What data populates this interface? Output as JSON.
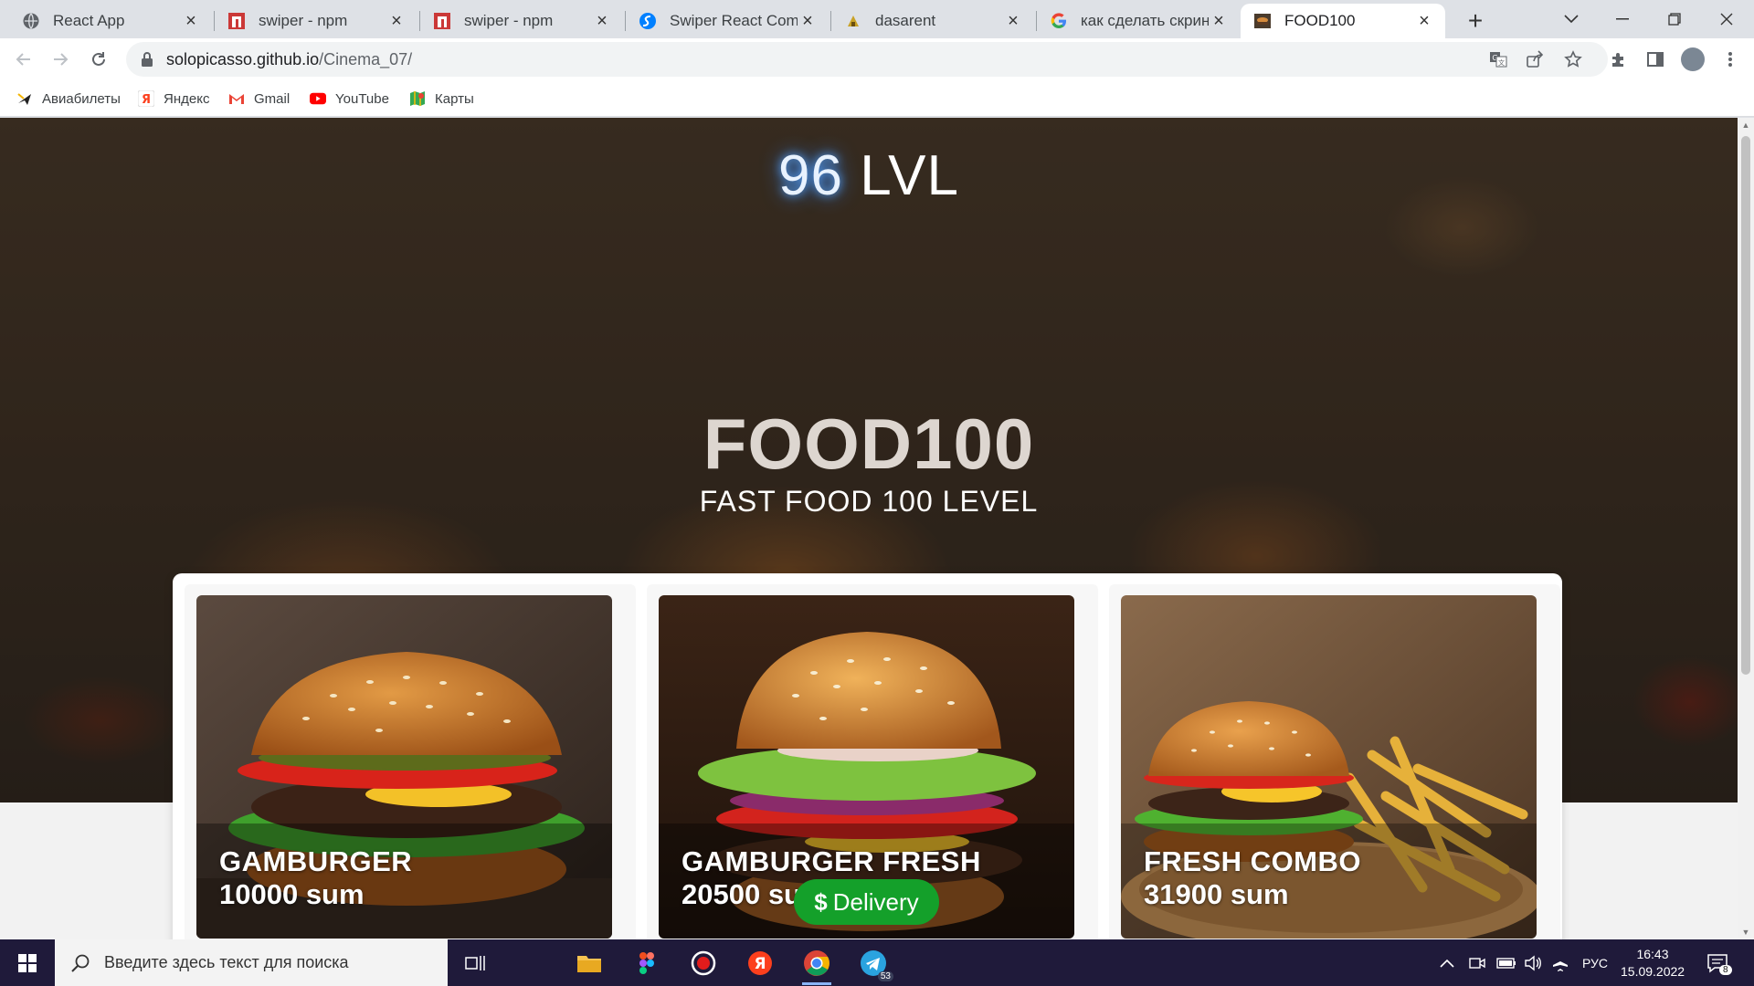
{
  "browser": {
    "tabs": [
      {
        "title": "React App",
        "icon": "globe-icon",
        "active": false
      },
      {
        "title": "swiper - npm",
        "icon": "npm-icon",
        "active": false
      },
      {
        "title": "swiper - npm",
        "icon": "npm-icon",
        "active": false
      },
      {
        "title": "Swiper React Compon",
        "icon": "swiper-icon",
        "active": false
      },
      {
        "title": "dasarent",
        "icon": "dasarent-icon",
        "active": false
      },
      {
        "title": "как сделать скриншо",
        "icon": "google-icon",
        "active": false
      },
      {
        "title": "FOOD100",
        "icon": "food-icon",
        "active": true
      }
    ],
    "url_host": "solopicasso.github.io",
    "url_path": "/Cinema_07/",
    "bookmarks": [
      {
        "label": "Авиабилеты",
        "icon": "plane-icon"
      },
      {
        "label": "Яндекс",
        "icon": "yandex-icon"
      },
      {
        "label": "Gmail",
        "icon": "gmail-icon"
      },
      {
        "label": "YouTube",
        "icon": "youtube-icon"
      },
      {
        "label": "Карты",
        "icon": "maps-icon"
      }
    ]
  },
  "page": {
    "logo_number": "96",
    "logo_text": "LVL",
    "brand": "FOOD100",
    "tagline": "FAST FOOD 100 LEVEL",
    "products": [
      {
        "name": "GAMBURGER",
        "price": "10000 sum"
      },
      {
        "name": "GAMBURGER FRESH",
        "price": "20500 sum"
      },
      {
        "name": "FRESH COMBO",
        "price": "31900 sum"
      }
    ],
    "delivery_symbol": "$",
    "delivery_label": "Delivery"
  },
  "taskbar": {
    "search_placeholder": "Введите здесь текст для поиска",
    "language": "РУС",
    "time": "16:43",
    "date": "15.09.2022",
    "telegram_badge": "53",
    "notification_count": "8"
  }
}
